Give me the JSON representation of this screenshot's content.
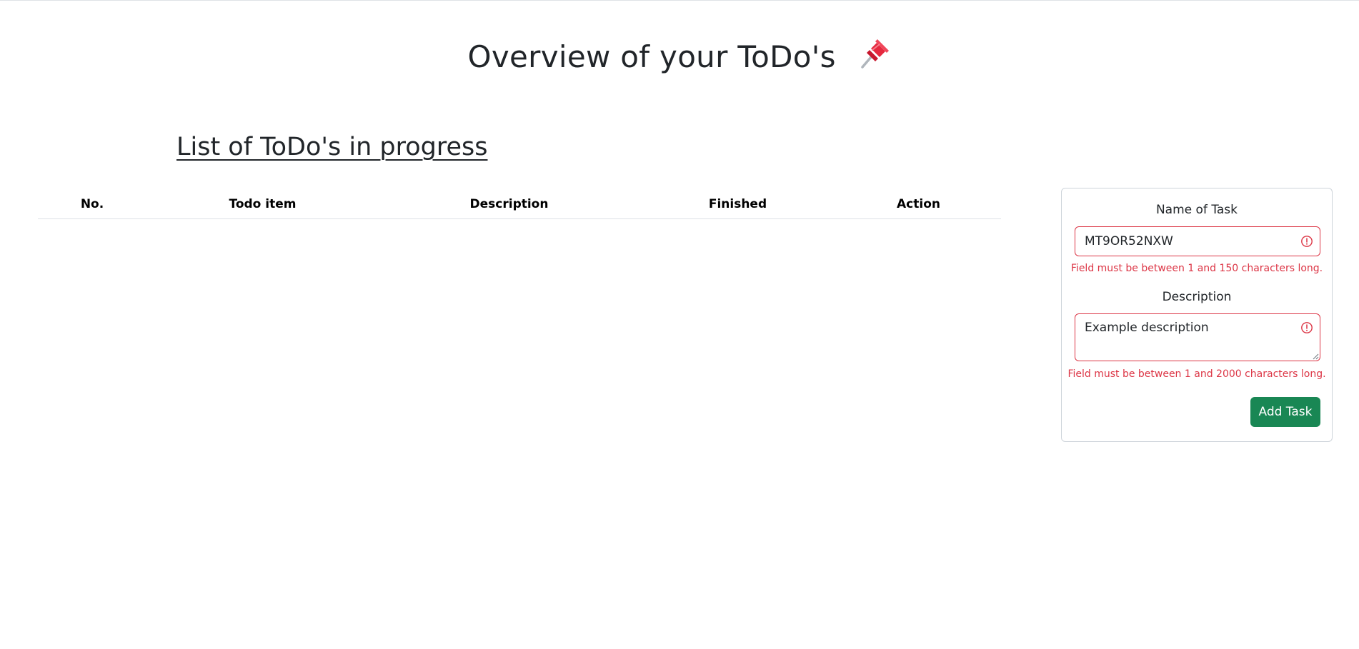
{
  "page": {
    "title": "Overview of your ToDo's",
    "title_icon": "pushpin-icon"
  },
  "list_section": {
    "title": "List of ToDo's in progress",
    "columns": [
      "No.",
      "Todo item",
      "Description",
      "Finished",
      "Action"
    ],
    "rows": []
  },
  "form": {
    "name_label": "Name of Task",
    "name_value": "MT9OR52NXW",
    "name_error": "Field must be between 1 and 150 characters long.",
    "description_label": "Description",
    "description_value": "Example description",
    "description_error": "Field must be between 1 and 2000 characters long.",
    "submit_label": "Add Task",
    "error_icon": "exclamation-circle-icon"
  },
  "colors": {
    "error": "#dc3545",
    "success": "#198754",
    "text": "#212529",
    "border": "#ced4da"
  }
}
